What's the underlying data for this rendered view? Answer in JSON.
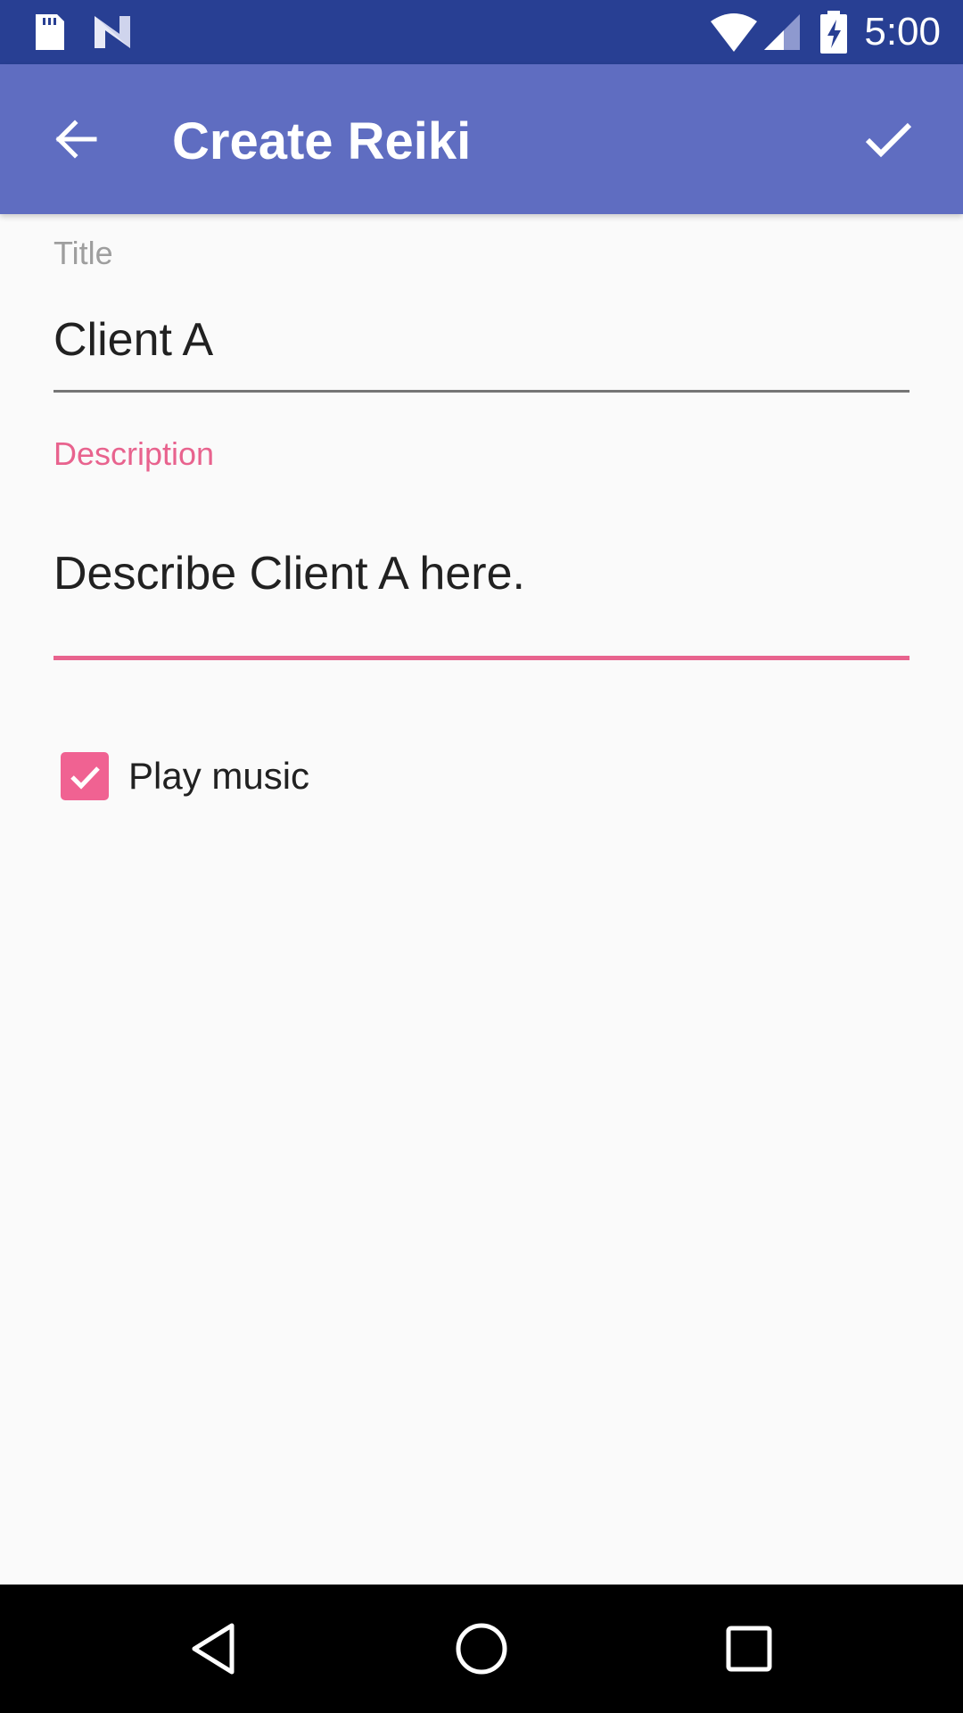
{
  "status_bar": {
    "time": "5:00",
    "icons": [
      "sd-card-icon",
      "n-notification-icon",
      "wifi-icon",
      "signal-icon",
      "battery-charging-icon"
    ]
  },
  "app_bar": {
    "title": "Create Reiki",
    "back_icon": "arrow-back-icon",
    "confirm_icon": "check-icon"
  },
  "form": {
    "title_field": {
      "label": "Title",
      "value": "Client A"
    },
    "description_field": {
      "label": "Description",
      "value": "Describe Client A here."
    },
    "play_music": {
      "label": "Play music",
      "checked": true
    }
  },
  "nav_bar": {
    "icons": [
      "back-triangle-icon",
      "home-circle-icon",
      "recents-square-icon"
    ]
  },
  "colors": {
    "status_bar": "#283F93",
    "app_bar": "#5F6DC1",
    "accent": "#E8638E",
    "checkbox": "#F06292",
    "background": "#FAFAFA"
  }
}
